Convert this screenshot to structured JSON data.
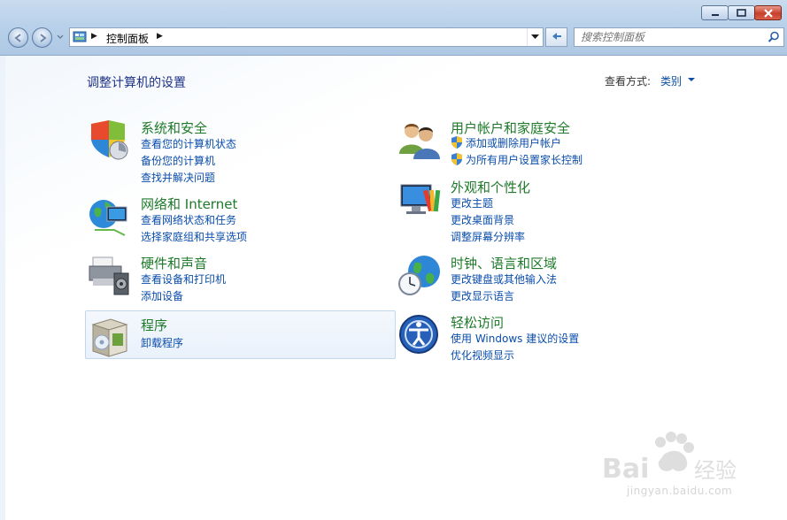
{
  "window": {
    "minimize_icon": "minimize-icon",
    "maximize_icon": "maximize-icon",
    "close_icon": "close-icon"
  },
  "address_bar": {
    "path": "控制面板"
  },
  "search": {
    "placeholder": "搜索控制面板"
  },
  "header": {
    "title": "调整计算机的设置",
    "view_label": "查看方式:",
    "view_value": "类别"
  },
  "categories": {
    "system": {
      "title": "系统和安全",
      "links": [
        "查看您的计算机状态",
        "备份您的计算机",
        "查找并解决问题"
      ]
    },
    "network": {
      "title": "网络和 Internet",
      "links": [
        "查看网络状态和任务",
        "选择家庭组和共享选项"
      ]
    },
    "hardware": {
      "title": "硬件和声音",
      "links": [
        "查看设备和打印机",
        "添加设备"
      ]
    },
    "programs": {
      "title": "程序",
      "links": [
        "卸载程序"
      ]
    },
    "users": {
      "title": "用户帐户和家庭安全",
      "links": [
        "添加或删除用户帐户",
        "为所有用户设置家长控制"
      ]
    },
    "appearance": {
      "title": "外观和个性化",
      "links": [
        "更改主题",
        "更改桌面背景",
        "调整屏幕分辨率"
      ]
    },
    "clock": {
      "title": "时钟、语言和区域",
      "links": [
        "更改键盘或其他输入法",
        "更改显示语言"
      ]
    },
    "ease": {
      "title": "轻松访问",
      "links": [
        "使用 Windows 建议的设置",
        "优化视频显示"
      ]
    }
  },
  "watermark": {
    "brand": "Baidu经验",
    "url": "jingyan.baidu.com"
  }
}
